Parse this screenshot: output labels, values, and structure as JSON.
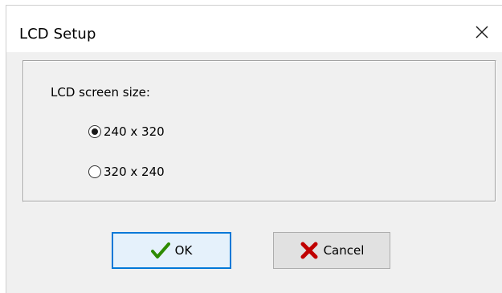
{
  "window": {
    "title": "LCD Setup"
  },
  "group": {
    "label": "LCD screen size:"
  },
  "options": [
    {
      "label": "240 x 320",
      "selected": true
    },
    {
      "label": "320 x 240",
      "selected": false
    }
  ],
  "buttons": {
    "ok_label": "OK",
    "cancel_label": "Cancel"
  },
  "icons": {
    "close": "close-icon",
    "ok": "checkmark-icon",
    "cancel": "cancel-x-icon"
  },
  "colors": {
    "dialog_bg": "#f0f0f0",
    "focus_border": "#0078d7",
    "ok_check": "#2e8b00",
    "cancel_x": "#c00000"
  }
}
